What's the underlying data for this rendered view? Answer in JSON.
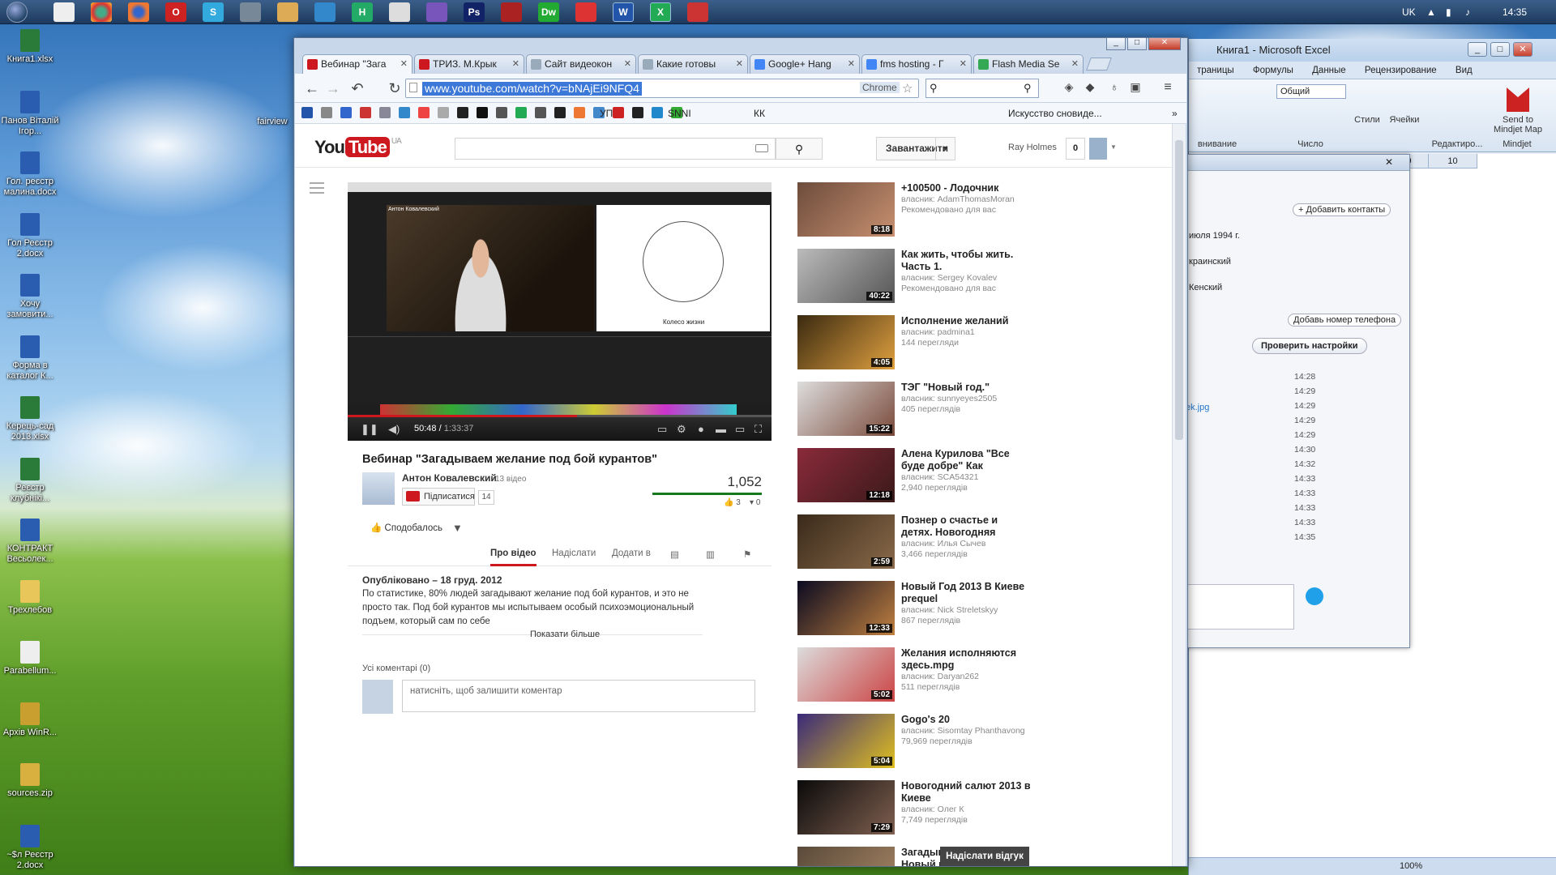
{
  "taskbar": {
    "pinned": [
      "start-icon",
      "document-icon",
      "chrome-icon",
      "firefox-icon",
      "opera-icon",
      "skype-icon",
      "tool-icon",
      "folder-icon",
      "globe-icon",
      "excel-icon",
      "doc-icon",
      "app-icon",
      "photoshop-icon",
      "book-icon",
      "dreamweaver-icon",
      "chrome2-icon",
      "word-icon",
      "excel2-icon",
      "player-icon"
    ],
    "lang": "UK",
    "clock": "14:35"
  },
  "desktop": {
    "icons": [
      "Книга1.xlsx",
      "Панов Віталій Ігор...",
      "Гол. реєстр малина.docx",
      "Гол Реєстр 2.docx",
      "Хочу замовити...",
      "Форма в каталог К...",
      "Керець-сад 2013.xlsx",
      "Реєстр клубнікі...",
      "КОНТРАКТ Весьолек...",
      "Трехлебов",
      "Parabellum...",
      "Архів WinR...",
      "sources.zip",
      "~$л Реєстр 2.docx"
    ],
    "folder_label": "fairview"
  },
  "excel": {
    "title": "Книга1 - Microsoft Excel",
    "menu": [
      "траницы",
      "Формулы",
      "Данные",
      "Рецензирование",
      "Вид"
    ],
    "number_format": "Общий",
    "ribbon_labels": [
      "Стили",
      "Ячейки",
      "Send to Mindjet Map",
      "Mindjet",
      "Редактиро...",
      "Число",
      "внивание"
    ],
    "columns": [
      "9",
      "10"
    ],
    "zoom": "100%"
  },
  "skype": {
    "add_contacts": "+ Добавить контакты",
    "date_text": "июля 1994 г.",
    "row1": "краинский",
    "row2": "Кенский",
    "add_phone": "Добавь номер телефона",
    "check_settings": "Проверить настройки",
    "file_link": "ek.jpg",
    "times": [
      "14:28",
      "14:29",
      "14:29",
      "14:29",
      "14:29",
      "14:30",
      "14:32",
      "14:33",
      "14:33",
      "14:33",
      "14:33",
      "14:35"
    ]
  },
  "chrome": {
    "tabs": [
      "Вебинар \"Зага",
      "ТРИЗ. М.Крык",
      "Сайт видеокон",
      "Какие готовы",
      "Google+ Hang",
      "fms hosting - Г",
      "Flash Media Se"
    ],
    "url": "www.youtube.com/watch?v=bNAjEi9NFQ4",
    "omnibox_badge": "Chrome",
    "bookmarks": [
      "УП",
      "SNNI",
      "КК",
      "Искусство сновиде..."
    ]
  },
  "youtube": {
    "locale": "UA",
    "upload": "Завантажити",
    "username": "Ray Holmes",
    "notifications": "0",
    "video": {
      "title": "Вебинар \"Загадываем желание под бой курантов\"",
      "current_time": "50:48",
      "total_time": "1:33:37",
      "progress": 0.542,
      "wheel_label": "Колесо жизни",
      "presenter": "Антон Ковалевский"
    },
    "channel": {
      "name": "Антон Ковалевский",
      "videos": "13 відео",
      "subscribe": "Підписатися",
      "subscribers": "14"
    },
    "views": "1,052",
    "likes": "3",
    "dislikes": "0",
    "like_label": "Сподобалось",
    "action_tabs": [
      "Про відео",
      "Надіслати",
      "Додати в"
    ],
    "published": "Опубліковано – 18 груд. 2012",
    "description": "По статистике, 80% людей загадывают желание под бой курантов, и это не просто так. Под бой курантов мы испытываем особый психоэмоциональный подъем, который сам по себе",
    "show_more": "Показати більше",
    "comments_title": "Усі коментарі (0)",
    "comment_placeholder": "натисніть, щоб залишити коментар",
    "feedback": "Надіслати відгук",
    "recommended": [
      {
        "title": "+100500 - Лодочник",
        "owner": "власник: AdamThomasMoran",
        "meta": "Рекомендовано для вас",
        "duration": "8:18"
      },
      {
        "title": "Как жить, чтобы жить. Часть 1.",
        "owner": "власник: Sergey Kovalev",
        "meta": "Рекомендовано для вас",
        "duration": "40:22"
      },
      {
        "title": "Исполнение желаний",
        "owner": "власник: padmina1",
        "meta": "144 перегляди",
        "duration": "4:05"
      },
      {
        "title": "ТЭГ \"Новый год.\"",
        "owner": "власник: sunnyeyes2505",
        "meta": "405 переглядів",
        "duration": "15:22"
      },
      {
        "title": "Алена Курилова \"Все буде добре\" Как",
        "owner": "власник: SCA54321",
        "meta": "2,940 переглядів",
        "duration": "12:18"
      },
      {
        "title": "Познер о счастье и детях. Новогодняя",
        "owner": "власник: Илья Сычев",
        "meta": "3,466 переглядів",
        "duration": "2:59"
      },
      {
        "title": "Новый Год 2013 В Киеве prequel",
        "owner": "власник: Nick Streletskyy",
        "meta": "867 переглядів",
        "duration": "12:33"
      },
      {
        "title": "Желания исполняются здесь.mpg",
        "owner": "власник: Daryan262",
        "meta": "511 переглядів",
        "duration": "5:02"
      },
      {
        "title": "Gogo's 20",
        "owner": "власник: Sisomtay Phanthavong",
        "meta": "79,969 переглядів",
        "duration": "5:04"
      },
      {
        "title": "Новогодний салют 2013 в Киеве",
        "owner": "власник: Олег К",
        "meta": "7,749 переглядів",
        "duration": "7:29"
      },
      {
        "title": "Загадываем жела... Новый год MOV",
        "owner": "",
        "meta": "",
        "duration": ""
      }
    ]
  }
}
